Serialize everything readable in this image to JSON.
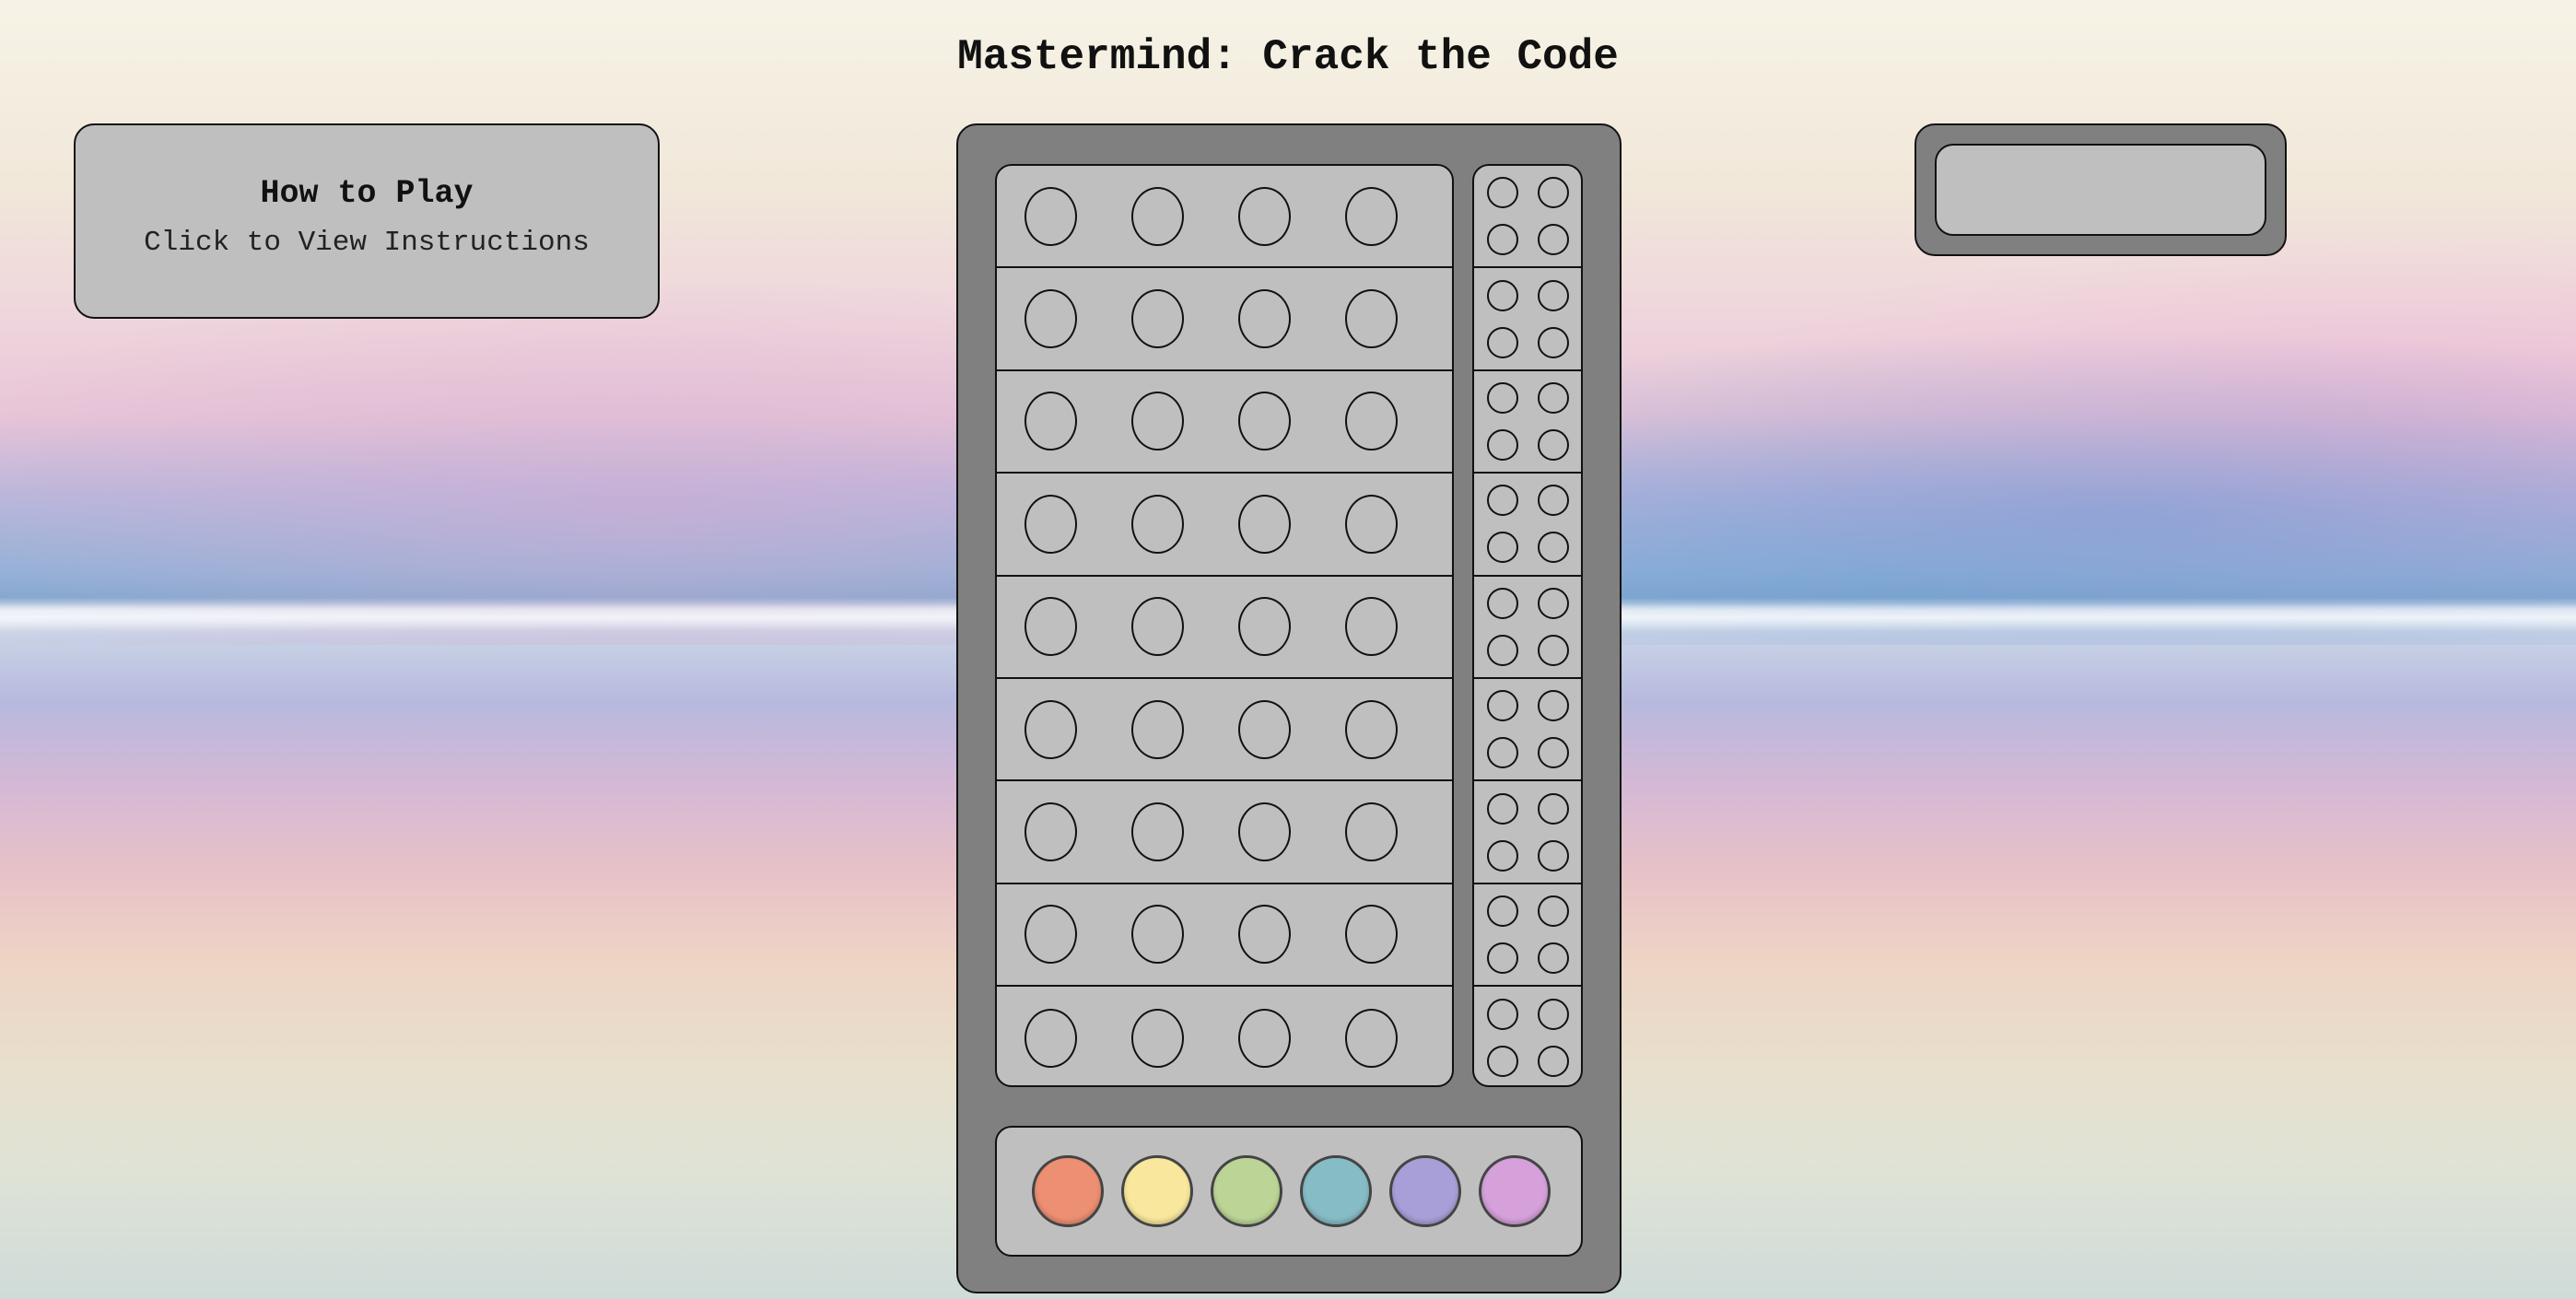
{
  "title": "Mastermind: Crack the Code",
  "howto": {
    "title": "How to Play",
    "subtitle": "Click to View Instructions"
  },
  "status": {
    "text": ""
  },
  "board": {
    "rows": 9,
    "pegs_per_row": 4,
    "feedback_pegs_per_row": 4
  },
  "palette": {
    "colors": [
      "#ec8f72",
      "#f8e79c",
      "#bcd596",
      "#86bcc6",
      "#a99fd8",
      "#d6a0db"
    ]
  }
}
